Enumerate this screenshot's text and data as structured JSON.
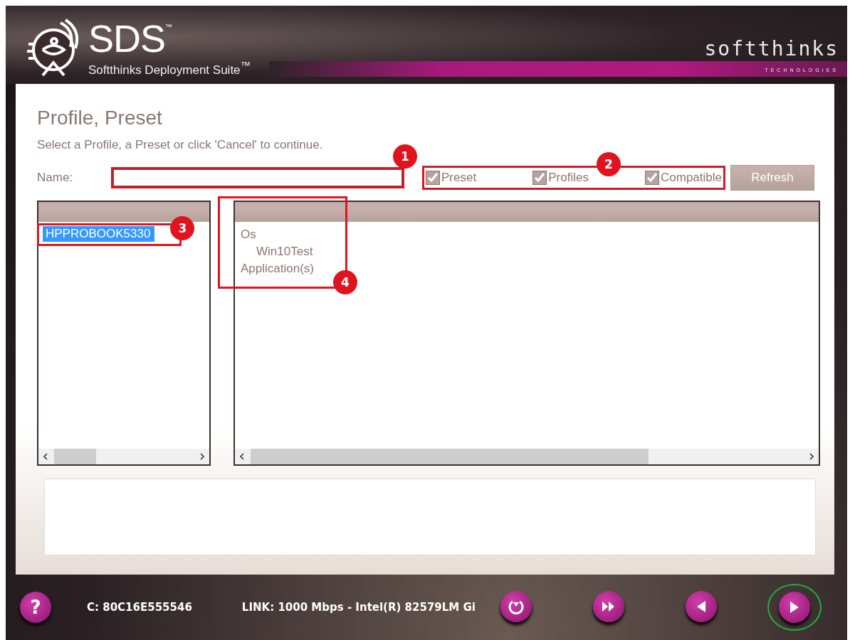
{
  "header": {
    "logo_text": "SDS",
    "logo_mark": "™",
    "product_name": "Softthinks Deployment Suite$^{™}$",
    "company": "softthinks",
    "company_sub": "TECHNOLOGIES"
  },
  "page": {
    "title": "Profile, Preset",
    "subtitle": "Select a Profile, a Preset or click 'Cancel' to continue."
  },
  "name_field": {
    "label": "Name:",
    "callout": "1"
  },
  "filters": {
    "callout": "2",
    "items": [
      {
        "label": "Preset",
        "checked": true
      },
      {
        "label": "Profiles",
        "checked": true
      },
      {
        "label": "Compatible",
        "checked": true
      }
    ]
  },
  "refresh_button": {
    "label": "Refresh"
  },
  "profiles": {
    "callout": "3",
    "items": [
      {
        "label": "HPPROBOOK5330",
        "selected": true
      }
    ]
  },
  "details": {
    "callout": "4",
    "tree": [
      {
        "label": "Os",
        "children": [
          {
            "label": "Win10Test"
          }
        ]
      },
      {
        "label": "Application(s)"
      }
    ]
  },
  "footer": {
    "disk": "C: 80C16E555546",
    "link": "LINK: 1000 Mbps - Intel(R) 82579LM Gi",
    "help": "?",
    "buttons": [
      {
        "kind": "restore",
        "highlighted": false
      },
      {
        "kind": "skip",
        "highlighted": false
      },
      {
        "kind": "back",
        "highlighted": false
      },
      {
        "kind": "next",
        "highlighted": true
      }
    ]
  }
}
